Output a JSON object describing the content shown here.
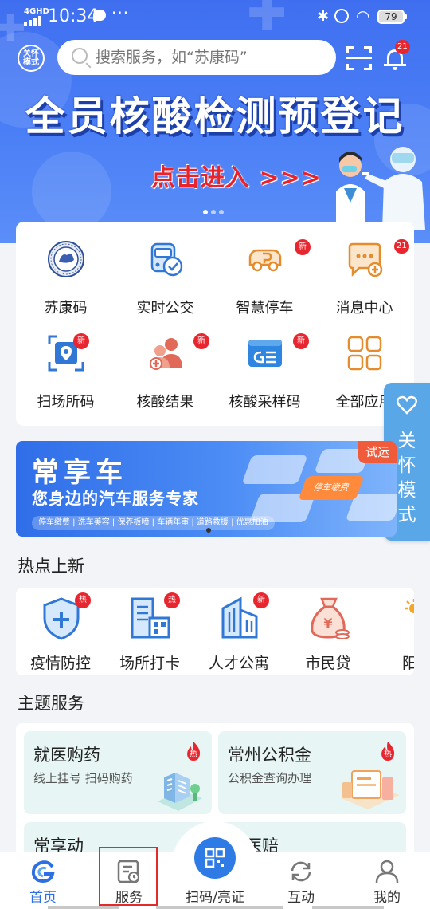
{
  "status_bar": {
    "network": "4GHD",
    "time": "10:34",
    "battery": "79"
  },
  "header": {
    "care_badge": "关怀模式",
    "search_placeholder": "搜索服务，如“苏康码”",
    "notification_count": "21"
  },
  "hero": {
    "title": "全员核酸检测预登记",
    "cta": "点击进入 >>>",
    "slide_count": 3,
    "active_slide": 1
  },
  "services": [
    {
      "label": "苏康码",
      "icon": "sukangma-seal-icon",
      "badge": ""
    },
    {
      "label": "实时公交",
      "icon": "bus-icon",
      "badge": ""
    },
    {
      "label": "智慧停车",
      "icon": "parking-car-icon",
      "badge": "新"
    },
    {
      "label": "消息中心",
      "icon": "message-icon",
      "badge": "21"
    },
    {
      "label": "扫场所码",
      "icon": "scan-place-icon",
      "badge": "新"
    },
    {
      "label": "核酸结果",
      "icon": "test-result-icon",
      "badge": "新"
    },
    {
      "label": "核酸采样码",
      "icon": "sampling-code-icon",
      "badge": "新"
    },
    {
      "label": "全部应用",
      "icon": "all-apps-icon",
      "badge": ""
    }
  ],
  "care_mode_tab": {
    "label": "关怀模式",
    "icon": "heart-icon"
  },
  "banner": {
    "title": "常享车",
    "subtitle": "您身边的汽车服务专家",
    "tags": "停车缴费 | 洗车美容 | 保养板喷 | 车辆年审 | 道路救援 | 优惠加油",
    "try_label": "试运",
    "tile_label": "停车缴费"
  },
  "sections": {
    "hot": "热点上新",
    "theme": "主题服务"
  },
  "hot_items": [
    {
      "label": "疫情防控",
      "icon": "shield-plus-icon",
      "badge": "热"
    },
    {
      "label": "场所打卡",
      "icon": "building-qr-icon",
      "badge": "热"
    },
    {
      "label": "人才公寓",
      "icon": "apartment-icon",
      "badge": "新"
    },
    {
      "label": "市民贷",
      "icon": "money-bag-icon",
      "badge": ""
    },
    {
      "label": "阳光",
      "icon": "sunshine-icon",
      "badge": ""
    }
  ],
  "theme_cards": [
    {
      "title": "就医购药",
      "subtitle": "线上挂号 扫码购药",
      "badge": "热"
    },
    {
      "title": "常州公积金",
      "subtitle": "公积金查询办理",
      "badge": "热"
    },
    {
      "title": "常享动",
      "subtitle": "",
      "badge": ""
    },
    {
      "title": "医赔",
      "subtitle": "",
      "badge": ""
    }
  ],
  "bottom_nav": [
    {
      "label": "首页",
      "icon": "home-logo-icon",
      "active": true
    },
    {
      "label": "服务",
      "icon": "service-icon",
      "active": false
    },
    {
      "label": "扫码/亮证",
      "icon": "qr-scan-icon",
      "active": false
    },
    {
      "label": "互动",
      "icon": "refresh-interact-icon",
      "active": false
    },
    {
      "label": "我的",
      "icon": "profile-icon",
      "active": false
    }
  ],
  "colors": {
    "brand_blue": "#3f6ff0",
    "badge_red": "#e8262f",
    "care_tab": "#5aa7e8",
    "theme_card_bg": "#e7f6f5"
  }
}
